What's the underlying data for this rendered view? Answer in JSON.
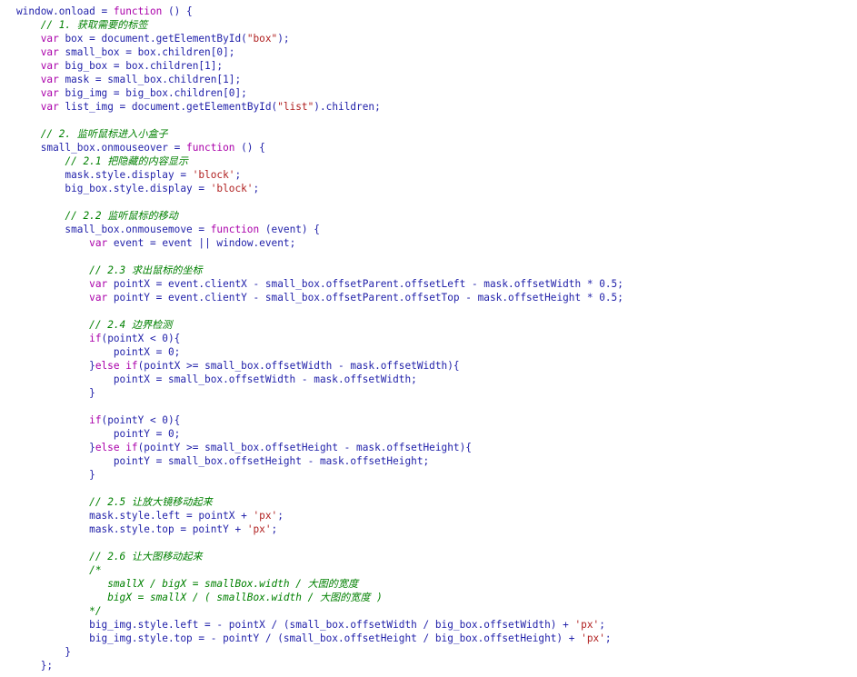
{
  "editor": {
    "lines": [
      [
        [
          "plain",
          "window.onload = "
        ],
        [
          "keyword",
          "function"
        ],
        [
          "plain",
          " () {"
        ]
      ],
      [
        [
          "plain",
          "    "
        ],
        [
          "comment",
          "// 1. 获取需要的标签"
        ]
      ],
      [
        [
          "plain",
          "    "
        ],
        [
          "keyword",
          "var"
        ],
        [
          "plain",
          " box = document.getElementById("
        ],
        [
          "string",
          "\"box\""
        ],
        [
          "plain",
          ");"
        ]
      ],
      [
        [
          "plain",
          "    "
        ],
        [
          "keyword",
          "var"
        ],
        [
          "plain",
          " small_box = box.children[0];"
        ]
      ],
      [
        [
          "plain",
          "    "
        ],
        [
          "keyword",
          "var"
        ],
        [
          "plain",
          " big_box = box.children[1];"
        ]
      ],
      [
        [
          "plain",
          "    "
        ],
        [
          "keyword",
          "var"
        ],
        [
          "plain",
          " mask = small_box.children[1];"
        ]
      ],
      [
        [
          "plain",
          "    "
        ],
        [
          "keyword",
          "var"
        ],
        [
          "plain",
          " big_img = big_box.children[0];"
        ]
      ],
      [
        [
          "plain",
          "    "
        ],
        [
          "keyword",
          "var"
        ],
        [
          "plain",
          " list_img = document.getElementById("
        ],
        [
          "string",
          "\"list\""
        ],
        [
          "plain",
          ").children;"
        ]
      ],
      [
        [
          "plain",
          ""
        ]
      ],
      [
        [
          "plain",
          "    "
        ],
        [
          "comment",
          "// 2. 监听鼠标进入小盒子"
        ]
      ],
      [
        [
          "plain",
          "    small_box.onmouseover = "
        ],
        [
          "keyword",
          "function"
        ],
        [
          "plain",
          " () {"
        ]
      ],
      [
        [
          "plain",
          "        "
        ],
        [
          "comment",
          "// 2.1 把隐藏的内容显示"
        ]
      ],
      [
        [
          "plain",
          "        mask.style.display = "
        ],
        [
          "string",
          "'block'"
        ],
        [
          "plain",
          ";"
        ]
      ],
      [
        [
          "plain",
          "        big_box.style.display = "
        ],
        [
          "string",
          "'block'"
        ],
        [
          "plain",
          ";"
        ]
      ],
      [
        [
          "plain",
          ""
        ]
      ],
      [
        [
          "plain",
          "        "
        ],
        [
          "comment",
          "// 2.2 监听鼠标的移动"
        ]
      ],
      [
        [
          "plain",
          "        small_box.onmousemove = "
        ],
        [
          "keyword",
          "function"
        ],
        [
          "plain",
          " (event) {"
        ]
      ],
      [
        [
          "plain",
          "            "
        ],
        [
          "keyword",
          "var"
        ],
        [
          "plain",
          " event = event || window.event;"
        ]
      ],
      [
        [
          "plain",
          ""
        ]
      ],
      [
        [
          "plain",
          "            "
        ],
        [
          "comment",
          "// 2.3 求出鼠标的坐标"
        ]
      ],
      [
        [
          "plain",
          "            "
        ],
        [
          "keyword",
          "var"
        ],
        [
          "plain",
          " pointX = event.clientX - small_box.offsetParent.offsetLeft - mask.offsetWidth * 0.5;"
        ]
      ],
      [
        [
          "plain",
          "            "
        ],
        [
          "keyword",
          "var"
        ],
        [
          "plain",
          " pointY = event.clientY - small_box.offsetParent.offsetTop - mask.offsetHeight * 0.5;"
        ]
      ],
      [
        [
          "plain",
          ""
        ]
      ],
      [
        [
          "plain",
          "            "
        ],
        [
          "comment",
          "// 2.4 边界检测"
        ]
      ],
      [
        [
          "plain",
          "            "
        ],
        [
          "keyword",
          "if"
        ],
        [
          "plain",
          "(pointX < 0){"
        ]
      ],
      [
        [
          "plain",
          "                pointX = 0;"
        ]
      ],
      [
        [
          "plain",
          "            }"
        ],
        [
          "keyword",
          "else if"
        ],
        [
          "plain",
          "(pointX >= small_box.offsetWidth - mask.offsetWidth){"
        ]
      ],
      [
        [
          "plain",
          "                pointX = small_box.offsetWidth - mask.offsetWidth;"
        ]
      ],
      [
        [
          "plain",
          "            }"
        ]
      ],
      [
        [
          "plain",
          ""
        ]
      ],
      [
        [
          "plain",
          "            "
        ],
        [
          "keyword",
          "if"
        ],
        [
          "plain",
          "(pointY < 0){"
        ]
      ],
      [
        [
          "plain",
          "                pointY = 0;"
        ]
      ],
      [
        [
          "plain",
          "            }"
        ],
        [
          "keyword",
          "else if"
        ],
        [
          "plain",
          "(pointY >= small_box.offsetHeight - mask.offsetHeight){"
        ]
      ],
      [
        [
          "plain",
          "                pointY = small_box.offsetHeight - mask.offsetHeight;"
        ]
      ],
      [
        [
          "plain",
          "            }"
        ]
      ],
      [
        [
          "plain",
          ""
        ]
      ],
      [
        [
          "plain",
          "            "
        ],
        [
          "comment",
          "// 2.5 让放大镜移动起来"
        ]
      ],
      [
        [
          "plain",
          "            mask.style.left = pointX + "
        ],
        [
          "string",
          "'px'"
        ],
        [
          "plain",
          ";"
        ]
      ],
      [
        [
          "plain",
          "            mask.style.top = pointY + "
        ],
        [
          "string",
          "'px'"
        ],
        [
          "plain",
          ";"
        ]
      ],
      [
        [
          "plain",
          ""
        ]
      ],
      [
        [
          "plain",
          "            "
        ],
        [
          "comment",
          "// 2.6 让大图移动起来"
        ]
      ],
      [
        [
          "plain",
          "            "
        ],
        [
          "comment",
          "/*"
        ]
      ],
      [
        [
          "plain",
          "               "
        ],
        [
          "comment",
          "smallX / bigX = smallBox.width / 大图的宽度"
        ]
      ],
      [
        [
          "plain",
          "               "
        ],
        [
          "comment",
          "bigX = smallX / ( smallBox.width / 大图的宽度 )"
        ]
      ],
      [
        [
          "plain",
          "            "
        ],
        [
          "comment",
          "*/"
        ]
      ],
      [
        [
          "plain",
          "            big_img.style.left = - pointX / (small_box.offsetWidth / big_box.offsetWidth) + "
        ],
        [
          "string",
          "'px'"
        ],
        [
          "plain",
          ";"
        ]
      ],
      [
        [
          "plain",
          "            big_img.style.top = - pointY / (small_box.offsetHeight / big_box.offsetHeight) + "
        ],
        [
          "string",
          "'px'"
        ],
        [
          "plain",
          ";"
        ]
      ],
      [
        [
          "plain",
          "        }"
        ]
      ],
      [
        [
          "plain",
          "    };"
        ]
      ]
    ]
  }
}
